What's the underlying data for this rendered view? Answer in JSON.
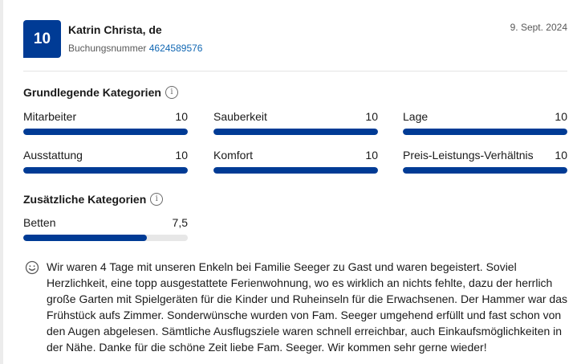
{
  "review": {
    "score": "10",
    "reviewer": "Katrin Christa, de",
    "booking_label": "Buchungsnummer",
    "booking_number": "4624589576",
    "date": "9. Sept. 2024"
  },
  "basic": {
    "title": "Grundlegende Kategorien",
    "items": [
      {
        "label": "Mitarbeiter",
        "score": "10",
        "fraction": 1.0
      },
      {
        "label": "Sauberkeit",
        "score": "10",
        "fraction": 1.0
      },
      {
        "label": "Lage",
        "score": "10",
        "fraction": 1.0
      },
      {
        "label": "Ausstattung",
        "score": "10",
        "fraction": 1.0
      },
      {
        "label": "Komfort",
        "score": "10",
        "fraction": 1.0
      },
      {
        "label": "Preis-Leistungs-Verhältnis",
        "score": "10",
        "fraction": 1.0
      }
    ]
  },
  "extra": {
    "title": "Zusätzliche Kategorien",
    "items": [
      {
        "label": "Betten",
        "score": "7,5",
        "fraction": 0.75
      }
    ]
  },
  "comment": {
    "icon": "smiley-icon",
    "text": "Wir waren 4 Tage mit unseren Enkeln bei Familie Seeger zu Gast und waren begeistert. Soviel Herzlichkeit, eine topp ausgestattete Ferienwohnung, wo es wirklich an nichts fehlte, dazu der herrlich große Garten mit Spielgeräten für die Kinder und Ruheinseln für die Erwachsenen. Der Hammer war das Frühstück aufs Zimmer. Sonderwünsche wurden von Fam. Seeger umgehend erfüllt und fast schon von den Augen abgelesen. Sämtliche Ausflugsziele waren schnell erreichbar, auch Einkaufsmöglichkeiten in der Nähe. Danke für die schöne Zeit liebe Fam. Seeger. Wir kommen sehr gerne wieder!"
  },
  "colors": {
    "accent": "#003b95",
    "link": "#1167b3",
    "track": "#e7e7e7"
  }
}
